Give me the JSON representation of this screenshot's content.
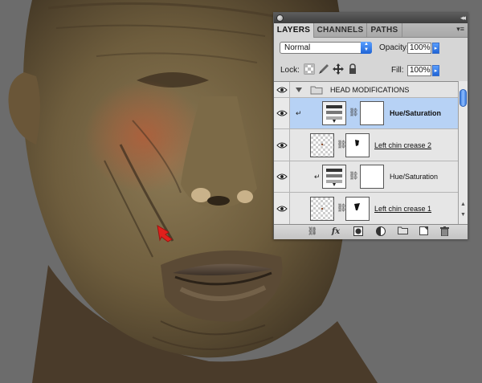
{
  "panel": {
    "tabs": [
      {
        "label": "LAYERS",
        "active": true
      },
      {
        "label": "CHANNELS",
        "active": false
      },
      {
        "label": "PATHS",
        "active": false
      }
    ],
    "collapse_glyph": "◂◂",
    "menu_glyph": "▾≡",
    "blend_mode": "Normal",
    "opacity_label": "Opacity:",
    "opacity_value": "100%",
    "lock_label": "Lock:",
    "fill_label": "Fill:",
    "fill_value": "100%"
  },
  "layers": [
    {
      "name": "HEAD MODIFICATIONS",
      "type": "group",
      "expanded": true,
      "visible": true
    },
    {
      "name": "Hue/Saturation",
      "type": "adjustment",
      "selected": true,
      "clipped": true,
      "visible": true
    },
    {
      "name": "Left chin crease 2",
      "type": "layer-with-mask",
      "selected": false,
      "visible": true
    },
    {
      "name": "Hue/Saturation",
      "type": "adjustment",
      "selected": false,
      "clipped": true,
      "visible": true
    },
    {
      "name": "Left chin crease 1",
      "type": "layer-with-mask",
      "selected": false,
      "visible": true
    }
  ],
  "footer_icons": [
    "link-layers-icon",
    "fx-icon",
    "mask-icon",
    "adjustment-icon",
    "group-icon",
    "new-layer-icon",
    "trash-icon"
  ],
  "colors": {
    "selected_row": "#b7d2f5",
    "accent_blue": "#2f6fd8",
    "arrow_marker": "#e0201c"
  }
}
